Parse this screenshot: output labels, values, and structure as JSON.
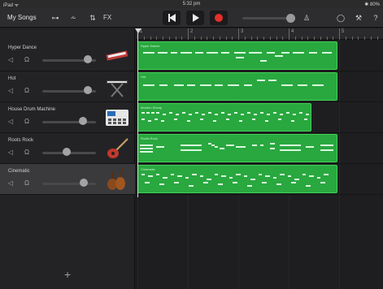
{
  "status_bar": {
    "device": "iPad ᯤ",
    "time": "5:32 pm",
    "battery": "✱ 80%"
  },
  "toolbar": {
    "my_songs": "My Songs",
    "fx_label": "FX",
    "icons": [
      "browser-icon",
      "mixer-icon",
      "track-settings-icon",
      "fx-icon",
      "rewind-icon",
      "play-icon",
      "record-icon",
      "metronome-icon",
      "loop-icon",
      "settings-icon",
      "help-icon"
    ]
  },
  "ruler": {
    "markers": [
      "1",
      "2",
      "3",
      "4",
      "5"
    ]
  },
  "tracks": [
    {
      "name": "Hyper Dance",
      "volume": 0.85,
      "instrument_icon": "keyboard-synth-icon"
    },
    {
      "name": "Hot",
      "volume": 0.85,
      "instrument_icon": "keyboard-stand-icon"
    },
    {
      "name": "House Drum Machine",
      "volume": 0.75,
      "instrument_icon": "drum-machine-icon"
    },
    {
      "name": "Roots Rock",
      "volume": 0.45,
      "instrument_icon": "electric-guitar-icon"
    },
    {
      "name": "Cinematic",
      "volume": 0.78,
      "instrument_icon": "string-section-icon"
    }
  ],
  "regions": [
    {
      "label": "Hyper Dance"
    },
    {
      "label": "Hot"
    },
    {
      "label": "Modern Stomp"
    },
    {
      "label": "Roots Rock"
    },
    {
      "label": "Cinematic"
    }
  ],
  "add_track_label": "+",
  "colors": {
    "region_green": "#29a83f",
    "region_border": "#3fd257",
    "record_red": "#e5302a"
  }
}
